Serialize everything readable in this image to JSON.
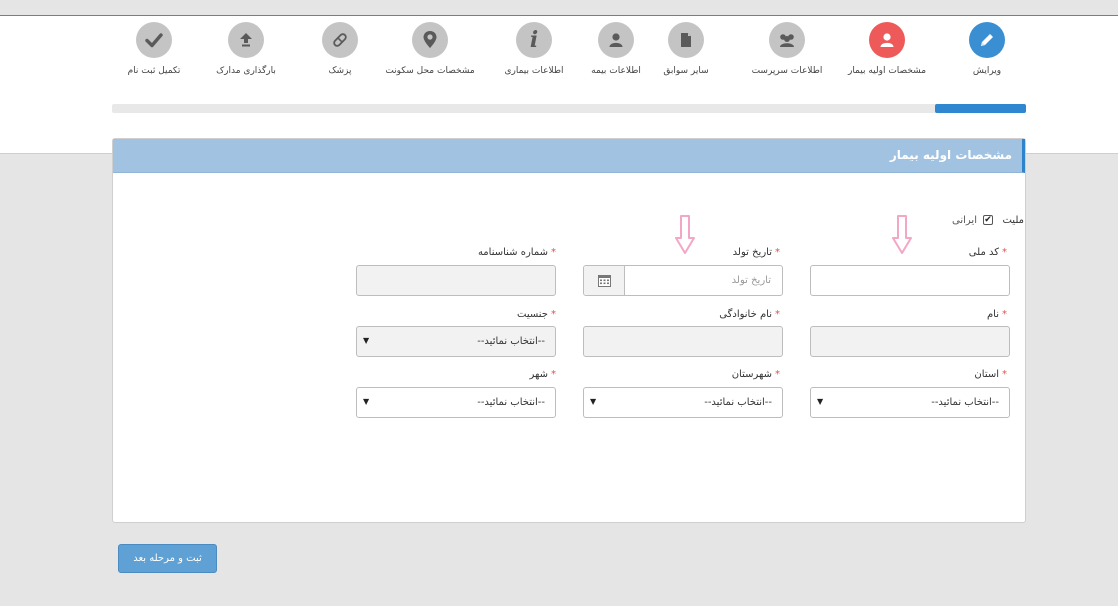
{
  "wizard": {
    "steps": [
      {
        "label": "ویرایش",
        "icon": "pencil-icon",
        "state": "done"
      },
      {
        "label": "مشخصات اولیه بیمار",
        "icon": "user-icon",
        "state": "current"
      },
      {
        "label": "اطلاعات سرپرست",
        "icon": "users-icon",
        "state": "todo"
      },
      {
        "label": "سایر سوابق",
        "icon": "file-icon",
        "state": "todo"
      },
      {
        "label": "اطلاعات بیمه",
        "icon": "user-icon",
        "state": "todo"
      },
      {
        "label": "اطلاعات بیماری",
        "icon": "info-icon",
        "state": "todo"
      },
      {
        "label": "مشخصات محل سکونت",
        "icon": "map-marker-icon",
        "state": "todo"
      },
      {
        "label": "پزشک",
        "icon": "pill-icon",
        "state": "todo"
      },
      {
        "label": "بارگذاری مدارک",
        "icon": "upload-icon",
        "state": "todo"
      },
      {
        "label": "تکمیل ثبت نام",
        "icon": "check-icon",
        "state": "todo"
      }
    ],
    "progress_fraction": 0.1
  },
  "panel": {
    "title": "مشخصات اولیه بیمار"
  },
  "form": {
    "nationality": {
      "label": "ملیت",
      "option": "ایرانی",
      "checked": true,
      "check_glyph": "✔"
    },
    "required_mark": "*",
    "national_code": {
      "label": "کد ملی",
      "value": ""
    },
    "birth_date": {
      "label": "تاریخ تولد",
      "placeholder": "تاریخ تولد"
    },
    "id_number": {
      "label": "شماره شناسنامه",
      "value": ""
    },
    "first_name": {
      "label": "نام",
      "value": ""
    },
    "last_name": {
      "label": "نام خانوادگی",
      "value": ""
    },
    "gender": {
      "label": "جنسیت",
      "selected": "--انتخاب نمائید--"
    },
    "province": {
      "label": "استان",
      "selected": "--انتخاب نمائید--"
    },
    "county": {
      "label": "شهرستان",
      "selected": "--انتخاب نمائید--"
    },
    "city": {
      "label": "شهر",
      "selected": "--انتخاب نمائید--"
    },
    "dropdown_arrow": "▼"
  },
  "actions": {
    "submit_label": "ثبت و مرحله بعد"
  },
  "colors": {
    "accent": "#3a8fd3",
    "current_step": "#ee5a5a",
    "panel_header": "#a1c3e1",
    "annotation_arrow": "#f4a6c6"
  }
}
